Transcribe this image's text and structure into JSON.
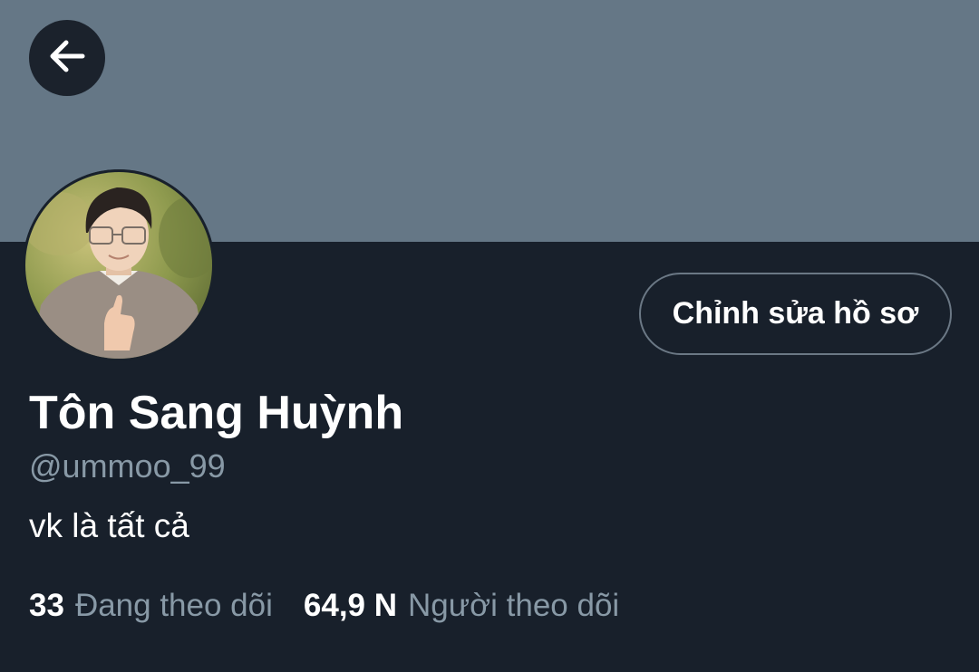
{
  "profile": {
    "display_name": "Tôn Sang Huỳnh",
    "handle": "@ummoo_99",
    "bio": "vk là tất cả",
    "edit_button_label": "Chỉnh sửa hồ sơ"
  },
  "stats": {
    "following_count": "33",
    "following_label": "Đang theo dõi",
    "followers_count": "64,9 N",
    "followers_label": "Người theo dõi"
  },
  "icons": {
    "back": "arrow-left-icon"
  },
  "colors": {
    "banner": "#657786",
    "background": "#18202b",
    "secondary_text": "#8899a6",
    "primary_text": "#ffffff",
    "button_border": "#6b7885"
  }
}
